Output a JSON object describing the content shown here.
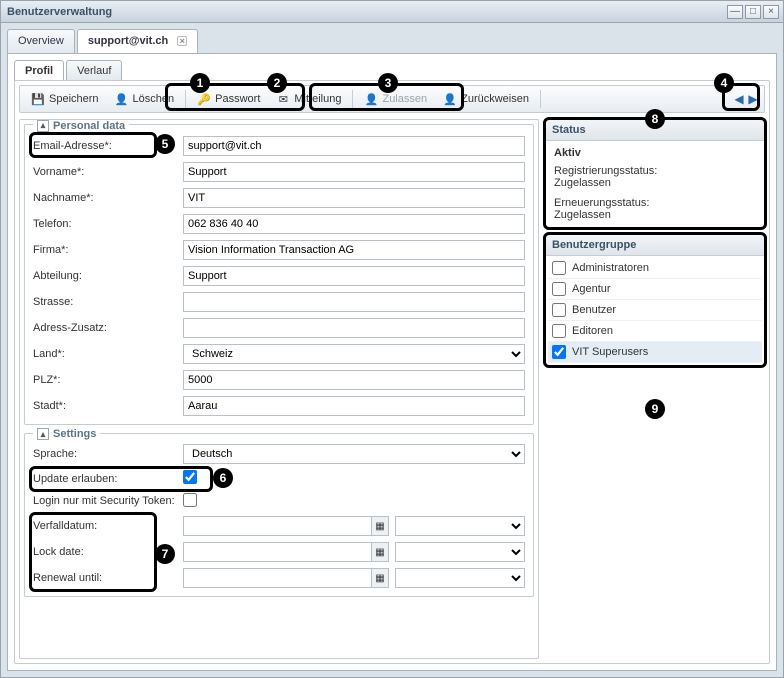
{
  "window": {
    "title": "Benutzerverwaltung"
  },
  "tabs_lvl1": {
    "overview": "Overview",
    "user": "support@vit.ch"
  },
  "tabs_lvl2": {
    "profil": "Profil",
    "verlauf": "Verlauf"
  },
  "toolbar": {
    "save": "Speichern",
    "delete": "Löschen",
    "passwort": "Passwort",
    "mitteilung": "Mitteilung",
    "zulassen": "Zulassen",
    "zurueckweisen": "Zurückweisen"
  },
  "callouts": {
    "c1": "1",
    "c2": "2",
    "c3": "3",
    "c4": "4",
    "c5": "5",
    "c6": "6",
    "c7": "7",
    "c8": "8",
    "c9": "9"
  },
  "personal": {
    "legend": "Personal data",
    "email_label": "Email-Adresse*:",
    "email": "support@vit.ch",
    "vorname_label": "Vorname*:",
    "vorname": "Support",
    "nachname_label": "Nachname*:",
    "nachname": "VIT",
    "telefon_label": "Telefon:",
    "telefon": "062 836 40 40",
    "firma_label": "Firma*:",
    "firma": "Vision Information Transaction AG",
    "abteilung_label": "Abteilung:",
    "abteilung": "Support",
    "strasse_label": "Strasse:",
    "strasse": "",
    "zusatz_label": "Adress-Zusatz:",
    "zusatz": "",
    "land_label": "Land*:",
    "land": "Schweiz",
    "plz_label": "PLZ*:",
    "plz": "5000",
    "stadt_label": "Stadt*:",
    "stadt": "Aarau"
  },
  "settings": {
    "legend": "Settings",
    "sprache_label": "Sprache:",
    "sprache": "Deutsch",
    "update_label": "Update erlauben:",
    "token_label": "Login nur mit Security Token:",
    "verfall_label": "Verfalldatum:",
    "lock_label": "Lock date:",
    "renewal_label": "Renewal until:"
  },
  "status": {
    "header": "Status",
    "aktiv": "Aktiv",
    "reg_label": "Registrierungsstatus:",
    "reg_value": "Zugelassen",
    "ern_label": "Erneuerungsstatus:",
    "ern_value": "Zugelassen"
  },
  "groups": {
    "header": "Benutzergruppe",
    "g1": "Administratoren",
    "g2": "Agentur",
    "g3": "Benutzer",
    "g4": "Editoren",
    "g5": "VIT Superusers"
  }
}
